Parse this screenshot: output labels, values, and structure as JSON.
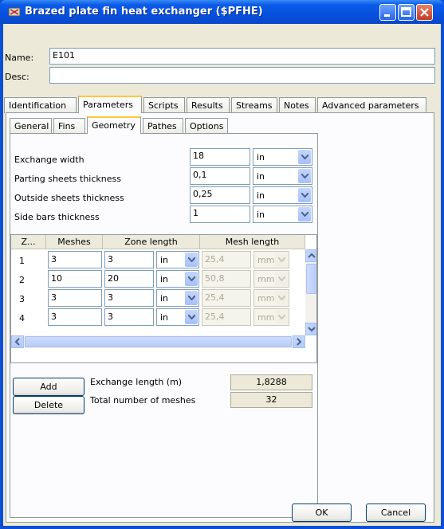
{
  "window": {
    "title": "Brazed plate fin heat exchanger ($PFHE)"
  },
  "name_label": "Name:",
  "name_value": "E101",
  "desc_label": "Desc:",
  "desc_value": "",
  "main_tabs": [
    "Identification",
    "Parameters",
    "Scripts",
    "Results",
    "Streams",
    "Notes",
    "Advanced parameters"
  ],
  "sub_tabs": [
    "General",
    "Fins",
    "Geometry",
    "Pathes",
    "Options"
  ],
  "geometry": [
    {
      "label": "Exchange width",
      "value": "18",
      "unit": "in"
    },
    {
      "label": "Parting sheets thickness",
      "value": "0,1",
      "unit": "in"
    },
    {
      "label": "Outside sheets thickness",
      "value": "0,25",
      "unit": "in"
    },
    {
      "label": "Side bars thickness",
      "value": "1",
      "unit": "in"
    }
  ],
  "grid": {
    "headers": [
      "Z...",
      "Meshes",
      "Zone length",
      "Mesh length"
    ],
    "rows": [
      {
        "z": "1",
        "meshes": "3",
        "zone": "3",
        "zone_unit": "in",
        "mesh": "25,4",
        "mesh_unit": "mm"
      },
      {
        "z": "2",
        "meshes": "10",
        "zone": "20",
        "zone_unit": "in",
        "mesh": "50,8",
        "mesh_unit": "mm"
      },
      {
        "z": "3",
        "meshes": "3",
        "zone": "3",
        "zone_unit": "in",
        "mesh": "25,4",
        "mesh_unit": "mm"
      },
      {
        "z": "4",
        "meshes": "3",
        "zone": "3",
        "zone_unit": "in",
        "mesh": "25,4",
        "mesh_unit": "mm"
      }
    ]
  },
  "add_label": "Add",
  "delete_label": "Delete",
  "exchange_length_label": "Exchange length (m)",
  "exchange_length_value": "1,8288",
  "total_meshes_label": "Total number of meshes",
  "total_meshes_value": "32",
  "ok_label": "OK",
  "cancel_label": "Cancel",
  "icons": [
    "app-icon",
    "minimize-icon",
    "maximize-icon",
    "close-icon",
    "chevron-down-icon",
    "scroll-up-icon",
    "scroll-down-icon",
    "scroll-left-icon",
    "scroll-right-icon"
  ]
}
